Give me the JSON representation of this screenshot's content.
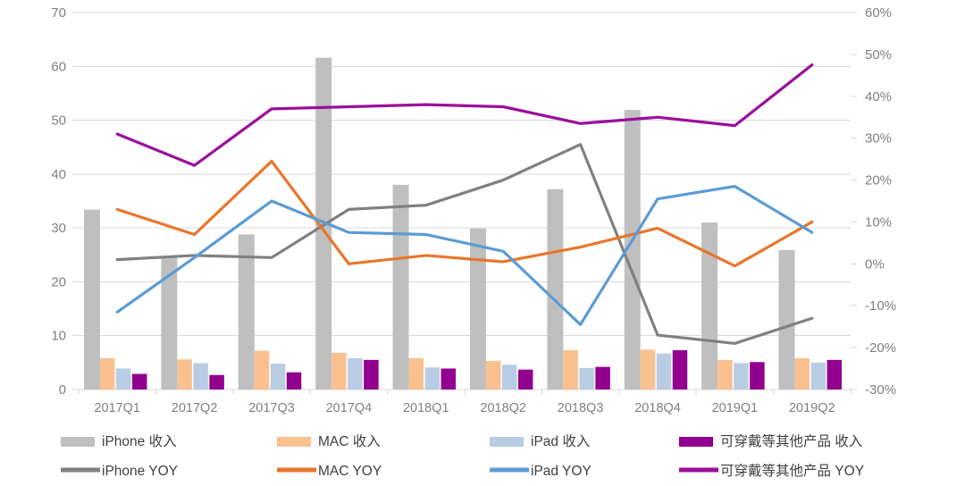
{
  "chart_data": {
    "type": "bar",
    "title": "",
    "subtitle": "",
    "xlabel": "",
    "ylabel": "",
    "y2label": "",
    "grid": true,
    "legend_position": "bottom",
    "categories": [
      "2017Q1",
      "2017Q2",
      "2017Q3",
      "2017Q4",
      "2018Q1",
      "2018Q2",
      "2018Q3",
      "2018Q4",
      "2019Q1",
      "2019Q2"
    ],
    "ylim": [
      0,
      70
    ],
    "yticks": [
      0,
      10,
      20,
      30,
      40,
      50,
      60,
      70
    ],
    "ytick_labels": [
      "0",
      "10",
      "20",
      "30",
      "40",
      "50",
      "60",
      "70"
    ],
    "y2lim": [
      -30,
      60
    ],
    "y2ticks": [
      -30,
      -20,
      -10,
      0,
      10,
      20,
      30,
      40,
      50,
      60
    ],
    "y2tick_labels": [
      "-30%",
      "-20%",
      "-10%",
      "0%",
      "10%",
      "20%",
      "30%",
      "40%",
      "50%",
      "60%"
    ],
    "bar_series": [
      {
        "name": "iPhone 收入",
        "color": "#BFBFBF",
        "axis": "left",
        "values": [
          33.4,
          24.8,
          28.8,
          61.6,
          38.0,
          29.9,
          37.2,
          51.9,
          31.0,
          25.9
        ]
      },
      {
        "name": "MAC 收入",
        "color": "#FAC090",
        "axis": "left",
        "values": [
          5.8,
          5.6,
          7.2,
          6.8,
          5.8,
          5.3,
          7.3,
          7.4,
          5.5,
          5.8
        ]
      },
      {
        "name": "iPad 收入",
        "color": "#B8CCE4",
        "axis": "left",
        "values": [
          3.9,
          4.9,
          4.8,
          5.8,
          4.1,
          4.6,
          4.0,
          6.7,
          4.9,
          5.0
        ]
      },
      {
        "name": "可穿戴等其他产品 收入",
        "color": "#92008F",
        "axis": "left",
        "values": [
          2.9,
          2.7,
          3.2,
          5.5,
          3.9,
          3.7,
          4.2,
          7.3,
          5.1,
          5.5
        ]
      }
    ],
    "line_series": [
      {
        "name": "iPhone YOY",
        "color": "#808080",
        "axis": "right",
        "values": [
          1.0,
          2.0,
          1.5,
          13.0,
          14.0,
          20.0,
          28.5,
          -17.0,
          -19.0,
          -13.0
        ]
      },
      {
        "name": "MAC YOY",
        "color": "#E8762C",
        "axis": "right",
        "values": [
          13.0,
          7.0,
          24.5,
          0.0,
          2.0,
          0.5,
          4.0,
          8.5,
          -0.5,
          10.0
        ]
      },
      {
        "name": "iPad YOY",
        "color": "#5B9BD5",
        "axis": "right",
        "values": [
          -11.5,
          1.5,
          15.0,
          7.5,
          7.0,
          3.0,
          -14.5,
          15.5,
          18.5,
          7.5
        ]
      },
      {
        "name": "可穿戴等其他产品 YOY",
        "color": "#9B0F9B",
        "axis": "right",
        "values": [
          31.0,
          23.5,
          37.0,
          37.5,
          38.0,
          37.5,
          33.5,
          35.0,
          33.0,
          47.5
        ]
      }
    ]
  },
  "legend": {
    "row1": [
      {
        "label": "iPhone 收入",
        "color": "#BFBFBF",
        "marker": "bar"
      },
      {
        "label": "MAC 收入",
        "color": "#FAC090",
        "marker": "bar"
      },
      {
        "label": "iPad 收入",
        "color": "#B8CCE4",
        "marker": "bar"
      },
      {
        "label": "可穿戴等其他产品 收入",
        "color": "#92008F",
        "marker": "bar"
      }
    ],
    "row2": [
      {
        "label": "iPhone YOY",
        "color": "#808080",
        "marker": "line"
      },
      {
        "label": "MAC YOY",
        "color": "#E8762C",
        "marker": "line"
      },
      {
        "label": "iPad YOY",
        "color": "#5B9BD5",
        "marker": "line"
      },
      {
        "label": "可穿戴等其他产品 YOY",
        "color": "#9B0F9B",
        "marker": "line"
      }
    ]
  }
}
